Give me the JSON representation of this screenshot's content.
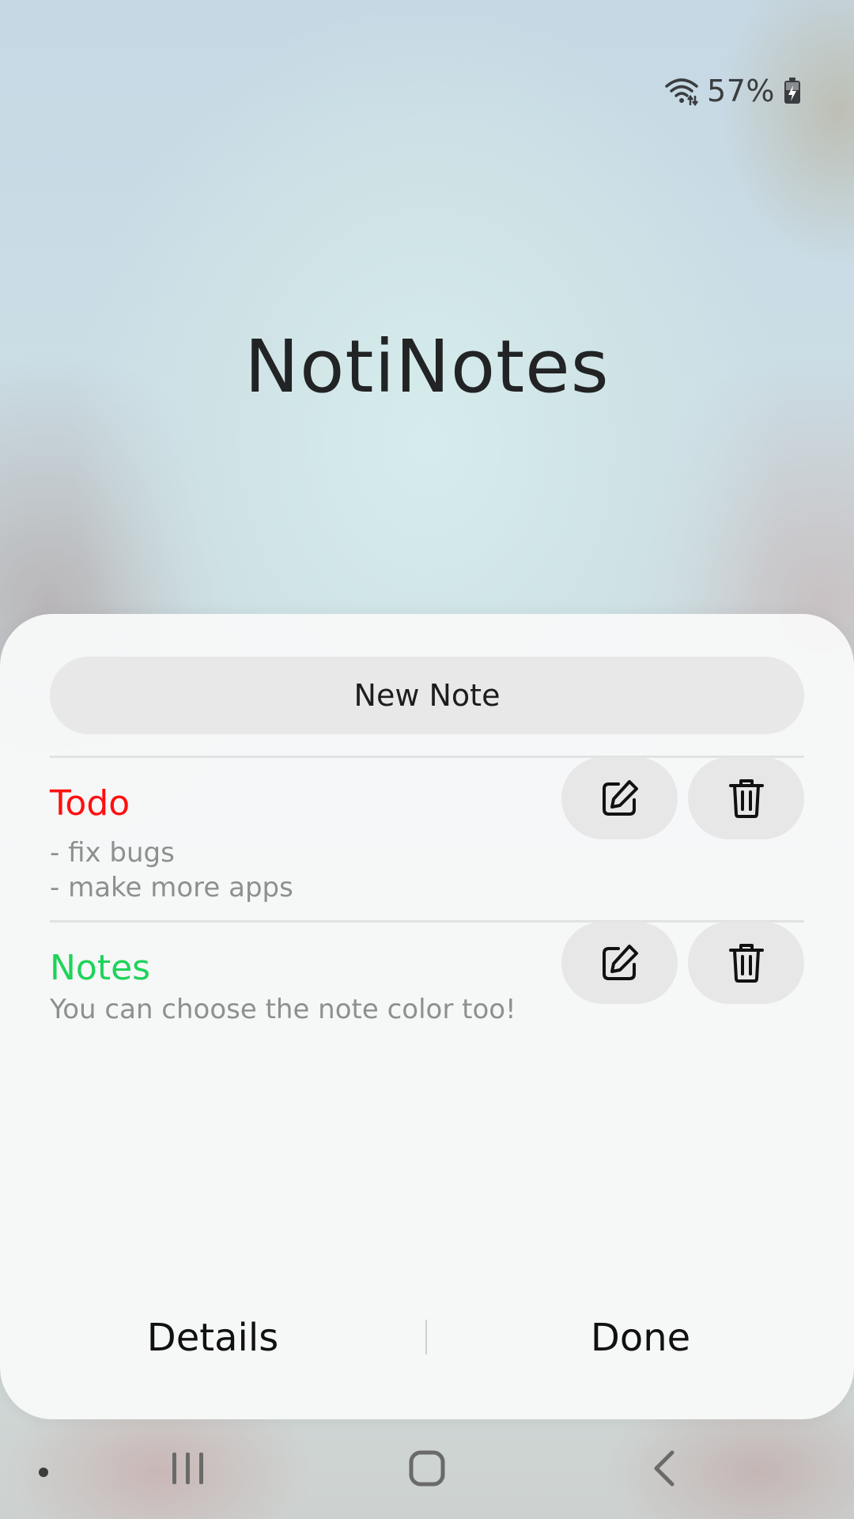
{
  "status_bar": {
    "battery_percent": "57%",
    "icons": [
      "wifi-icon",
      "battery-charging-icon"
    ]
  },
  "app": {
    "title": "NotiNotes"
  },
  "dialog": {
    "new_note_label": "New Note",
    "notes": [
      {
        "title": "Todo",
        "body": "- fix bugs\n- make more apps",
        "color": "#ff0f0f",
        "edit_icon": "edit-icon",
        "delete_icon": "trash-icon"
      },
      {
        "title": "Notes",
        "body": "You can choose the note color too!",
        "color": "#1ed35a",
        "edit_icon": "edit-icon",
        "delete_icon": "trash-icon"
      }
    ],
    "details_label": "Details",
    "done_label": "Done"
  },
  "nav_bar": {
    "icons": [
      "nav-dot-icon",
      "recents-icon",
      "home-icon",
      "back-icon"
    ]
  }
}
